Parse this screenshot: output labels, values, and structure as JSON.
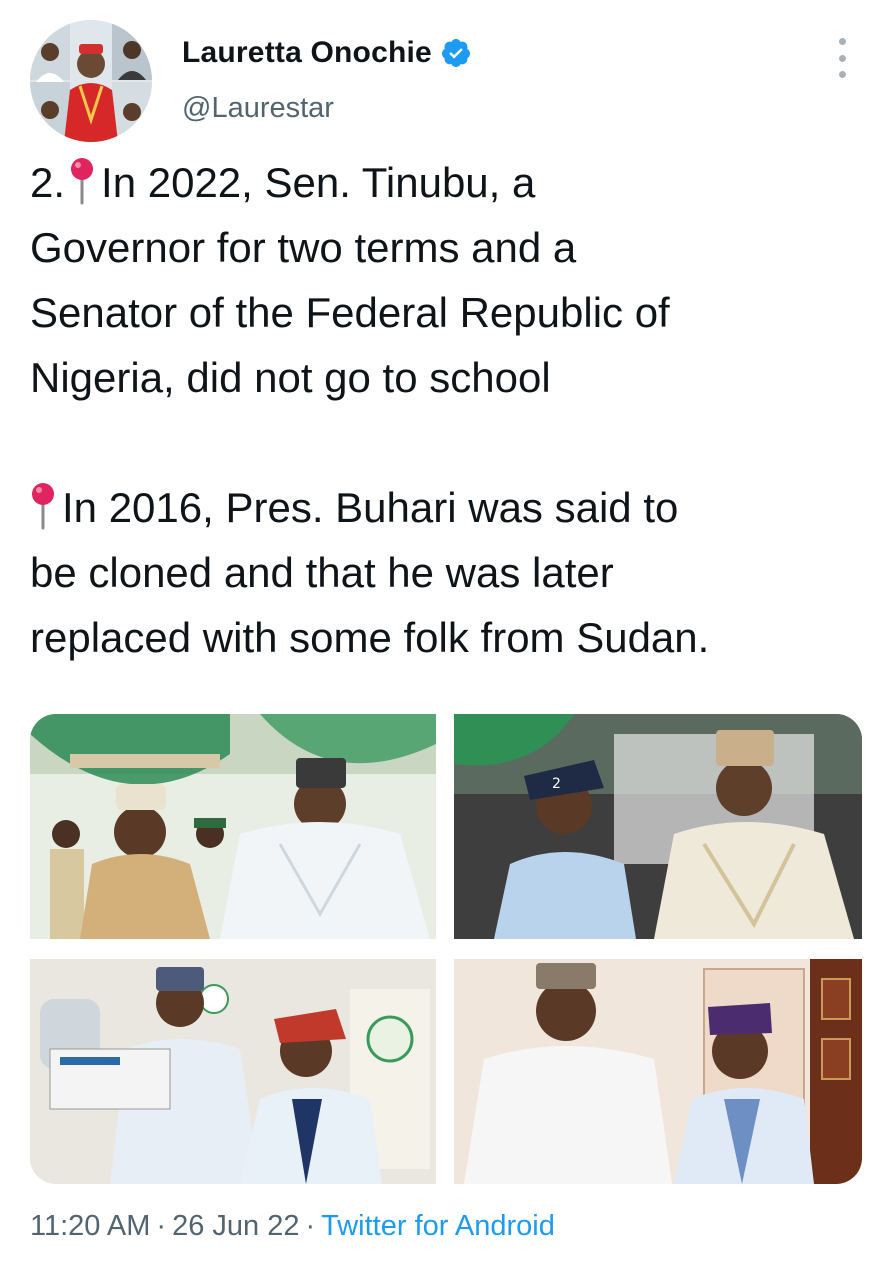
{
  "author": {
    "display_name": "Lauretta Onochie",
    "handle": "@Laurestar",
    "verified": true,
    "verified_color": "#1d9bf0"
  },
  "tweet": {
    "line1_prefix": "2.",
    "line1_text": "In 2022, Sen. Tinubu, a",
    "line2": "Governor for two terms and a",
    "line3": "Senator of the Federal Republic of",
    "line4": "Nigeria, did not go to school",
    "line5_text": "In 2016, Pres. Buhari was said to",
    "line6": "be cloned and that he was later",
    "line7": "replaced with some folk from Sudan."
  },
  "meta": {
    "time": "11:20 AM",
    "separator": "·",
    "date": "26 Jun 22",
    "source": "Twitter for Android"
  },
  "colors": {
    "text": "#0f1419",
    "muted": "#536471",
    "link": "#1d9bf0",
    "pin": "#e0245e"
  },
  "icons": {
    "pin": "round-pushpin-icon",
    "verified": "verified-badge-icon",
    "more": "more-options-icon"
  }
}
